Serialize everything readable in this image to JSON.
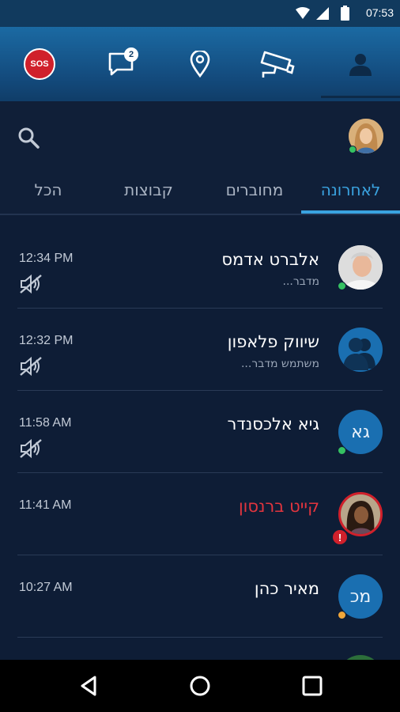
{
  "status_bar": {
    "time": "07:53"
  },
  "toolbar": {
    "sos_label": "SOS",
    "messages_badge": "2",
    "items": [
      "sos",
      "messages",
      "location",
      "camera",
      "profile"
    ]
  },
  "tabs": [
    {
      "label": "לאחרונה",
      "active": true
    },
    {
      "label": "מחוברים",
      "active": false
    },
    {
      "label": "קבוצות",
      "active": false
    },
    {
      "label": "הכל",
      "active": false
    }
  ],
  "conversations": [
    {
      "name": "אלברט אדמס",
      "subtitle": "מדבר...",
      "time": "12:34 PM",
      "status": "online",
      "muted": true,
      "avatar": "photo"
    },
    {
      "name": "שיווק פלאפון",
      "subtitle": "משתמש מדבר...",
      "time": "12:32 PM",
      "status": "",
      "muted": true,
      "avatar": "group"
    },
    {
      "name": "גיא אלכסנדר",
      "subtitle": "",
      "time": "11:58 AM",
      "status": "online",
      "muted": true,
      "avatar": "initials",
      "initials": "גא"
    },
    {
      "name": "קייט ברנסון",
      "subtitle": "",
      "time": "11:41 AM",
      "status": "alert",
      "muted": false,
      "avatar": "photo"
    },
    {
      "name": "מאיר כהן",
      "subtitle": "",
      "time": "10:27 AM",
      "status": "away",
      "muted": false,
      "avatar": "initials",
      "initials": "מכ"
    }
  ],
  "colors": {
    "accent": "#3aa3e0",
    "online": "#35c162",
    "away": "#f0a63a",
    "alert": "#d0202b",
    "background": "#0e1d36"
  }
}
